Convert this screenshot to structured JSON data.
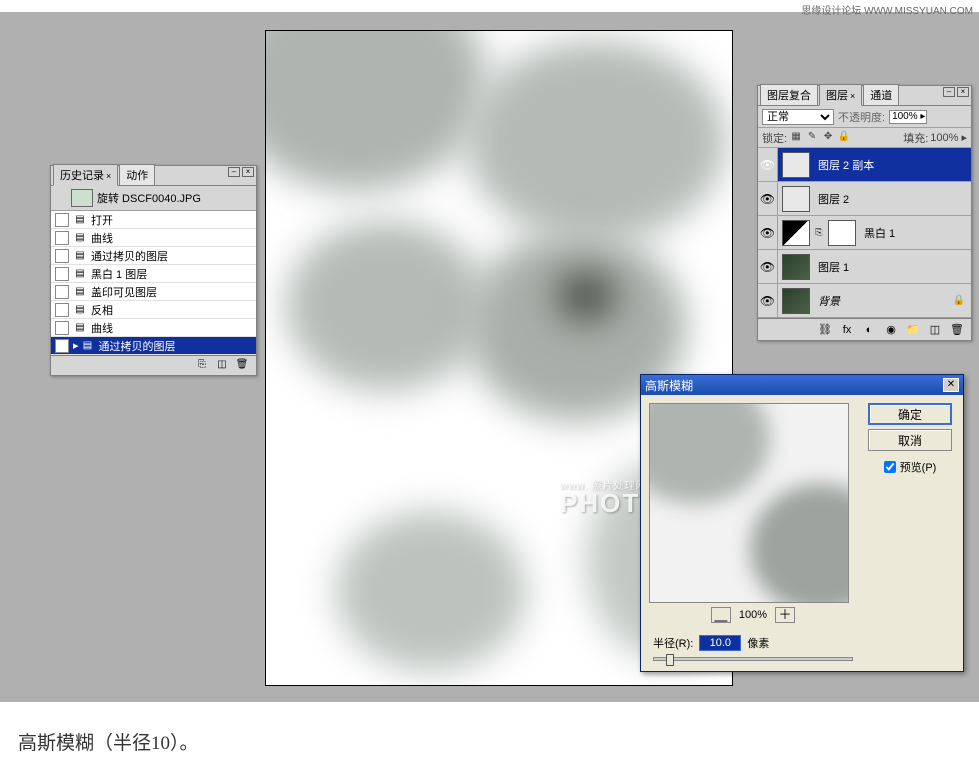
{
  "watermark_top": "思缘设计论坛 WWW.MISSYUAN.COM",
  "watermark_center_small": "www.            照片处理网",
  "watermark_center": "PHOTOPS.COM",
  "caption": "高斯模糊（半径10）。",
  "history": {
    "tabs": {
      "history": "历史记录",
      "actions": "动作"
    },
    "snapshot": "旋转 DSCF0040.JPG",
    "items": [
      "打开",
      "曲线",
      "通过拷贝的图层",
      "黑白 1 图层",
      "盖印可见图层",
      "反相",
      "曲线",
      "通过拷贝的图层"
    ]
  },
  "layers": {
    "tabs": {
      "comps": "图层复合",
      "layers": "图层",
      "channels": "通道"
    },
    "blend_mode": "正常",
    "opacity_label": "不透明度:",
    "opacity_value": "100% ▸",
    "lock_label": "锁定:",
    "fill_label": "填充:",
    "fill_value": "100% ▸",
    "items": [
      {
        "name": "图层 2 副本"
      },
      {
        "name": "图层 2"
      },
      {
        "name": "黑白 1"
      },
      {
        "name": "图层 1"
      },
      {
        "name": "背景"
      }
    ]
  },
  "dialog": {
    "title": "高斯模糊",
    "ok": "确定",
    "cancel": "取消",
    "preview": "预览(P)",
    "zoom": "100%",
    "radius_label": "半径(R):",
    "radius_value": "10.0",
    "radius_unit": "像素"
  }
}
